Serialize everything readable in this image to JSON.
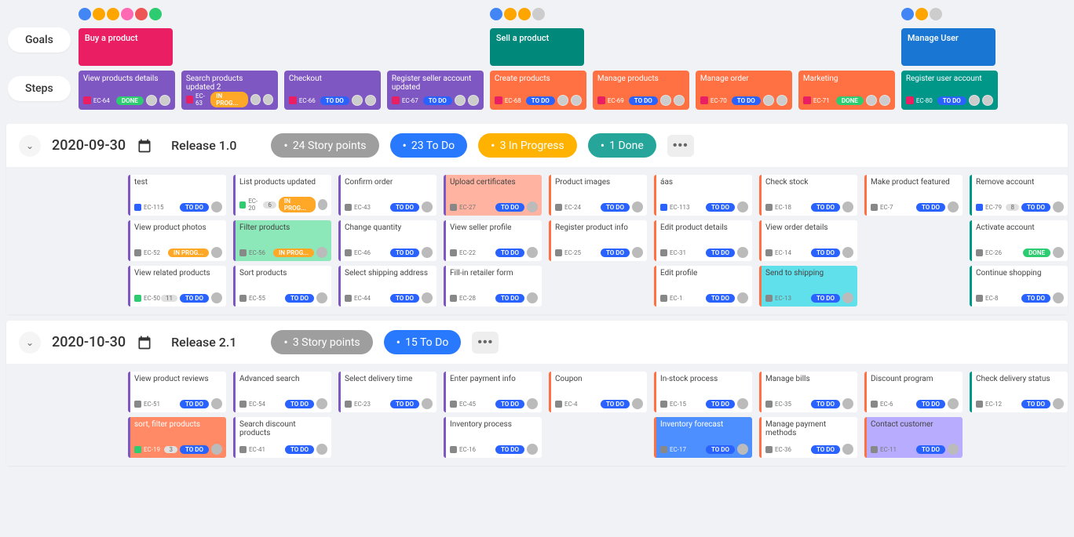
{
  "sideLabels": {
    "goals": "Goals",
    "steps": "Steps"
  },
  "goals": [
    {
      "title": "Buy a product",
      "cardClass": "goal-pink",
      "avatars": [
        "b",
        "o",
        "o",
        "p",
        "r",
        "g"
      ]
    },
    {
      "title": "Sell a product",
      "cardClass": "goal-teal",
      "avatars": [
        "b",
        "o",
        "o",
        "gray"
      ]
    },
    {
      "title": "Manage User",
      "cardClass": "goal-blue",
      "avatars": [
        "b",
        "o",
        "gray"
      ]
    }
  ],
  "steps": [
    {
      "title": "View products details",
      "id": "EC-64",
      "status": "DONE",
      "statusClass": "badge-done",
      "cardClass": "step-purple",
      "col": 0
    },
    {
      "title": "Search products updated 2",
      "id": "EC-63",
      "status": "IN PROG...",
      "statusClass": "badge-prog",
      "cardClass": "step-purple",
      "col": 1
    },
    {
      "title": "Checkout",
      "id": "EC-66",
      "status": "TO DO",
      "statusClass": "badge-todo",
      "cardClass": "step-purple",
      "col": 2
    },
    {
      "title": "Register seller account updated",
      "id": "EC-67",
      "status": "TO DO",
      "statusClass": "badge-todo",
      "cardClass": "step-purple",
      "col": 3
    },
    {
      "title": "Create products",
      "id": "EC-68",
      "status": "TO DO",
      "statusClass": "badge-todo",
      "cardClass": "step-orange",
      "col": 4
    },
    {
      "title": "Manage products",
      "id": "EC-69",
      "status": "TO DO",
      "statusClass": "badge-todo",
      "cardClass": "step-orange",
      "col": 5
    },
    {
      "title": "Manage order",
      "id": "EC-70",
      "status": "TO DO",
      "statusClass": "badge-todo",
      "cardClass": "step-orange",
      "col": 6
    },
    {
      "title": "Marketing",
      "id": "EC-71",
      "status": "DONE",
      "statusClass": "badge-done",
      "cardClass": "step-orange",
      "col": 7
    },
    {
      "title": "Register user account",
      "id": "EC-80",
      "status": "TO DO",
      "statusClass": "badge-todo",
      "cardClass": "step-teal",
      "col": 8
    }
  ],
  "releases": [
    {
      "date": "2020-09-30",
      "name": "Release 1.0",
      "chips": [
        {
          "text": "24 Story points",
          "class": "chip-gray"
        },
        {
          "text": "23 To Do",
          "class": "chip-blue"
        },
        {
          "text": "3 In Progress",
          "class": "chip-orange"
        },
        {
          "text": "1 Done",
          "class": "chip-green"
        }
      ],
      "tasks": [
        {
          "title": "test",
          "id": "EC-115",
          "iconClass": "task",
          "status": "TO DO",
          "statusClass": "badge-todo",
          "borderClass": "bl-purple",
          "col": 0,
          "row": 0
        },
        {
          "title": "List products updated",
          "id": "EC-20",
          "iconClass": "story",
          "count": "6",
          "status": "IN PROG...",
          "statusClass": "badge-prog",
          "borderClass": "bl-purple",
          "col": 1,
          "row": 0
        },
        {
          "title": "Confirm order",
          "id": "EC-43",
          "iconClass": "sub",
          "status": "TO DO",
          "statusClass": "badge-todo",
          "borderClass": "bl-purple",
          "col": 2,
          "row": 0
        },
        {
          "title": "Upload certificates",
          "id": "EC-27",
          "iconClass": "sub",
          "status": "TO DO",
          "statusClass": "badge-todo",
          "borderClass": "bl-purple",
          "hl": "hl-peach",
          "col": 3,
          "row": 0
        },
        {
          "title": "Product images",
          "id": "EC-24",
          "iconClass": "sub",
          "status": "TO DO",
          "statusClass": "badge-todo",
          "borderClass": "bl-orange",
          "col": 4,
          "row": 0
        },
        {
          "title": "áas",
          "id": "EC-113",
          "iconClass": "task",
          "status": "TO DO",
          "statusClass": "badge-todo",
          "borderClass": "bl-orange",
          "col": 5,
          "row": 0
        },
        {
          "title": "Check stock",
          "id": "EC-18",
          "iconClass": "sub",
          "status": "TO DO",
          "statusClass": "badge-todo",
          "borderClass": "bl-orange",
          "col": 6,
          "row": 0
        },
        {
          "title": "Make product featured",
          "id": "EC-7",
          "iconClass": "sub",
          "status": "TO DO",
          "statusClass": "badge-todo",
          "borderClass": "bl-orange",
          "col": 7,
          "row": 0
        },
        {
          "title": "Remove account",
          "id": "EC-79",
          "iconClass": "task",
          "count": "8",
          "status": "TO DO",
          "statusClass": "badge-todo",
          "borderClass": "bl-teal",
          "col": 8,
          "row": 0
        },
        {
          "title": "View product photos",
          "id": "EC-52",
          "iconClass": "sub",
          "status": "IN PROG...",
          "statusClass": "badge-prog",
          "borderClass": "bl-purple",
          "col": 0,
          "row": 1
        },
        {
          "title": "Filter products",
          "id": "EC-56",
          "iconClass": "sub",
          "status": "IN PROG...",
          "statusClass": "badge-prog",
          "borderClass": "bl-purple",
          "hl": "hl-mint",
          "col": 1,
          "row": 1
        },
        {
          "title": "Change quantity",
          "id": "EC-46",
          "iconClass": "sub",
          "status": "TO DO",
          "statusClass": "badge-todo",
          "borderClass": "bl-purple",
          "col": 2,
          "row": 1
        },
        {
          "title": "View seller profile",
          "id": "EC-22",
          "iconClass": "sub",
          "status": "TO DO",
          "statusClass": "badge-todo",
          "borderClass": "bl-purple",
          "col": 3,
          "row": 1
        },
        {
          "title": "Register product info",
          "id": "EC-25",
          "iconClass": "sub",
          "status": "TO DO",
          "statusClass": "badge-todo",
          "borderClass": "bl-orange",
          "col": 4,
          "row": 1
        },
        {
          "title": "Edit product details",
          "id": "EC-31",
          "iconClass": "sub",
          "status": "TO DO",
          "statusClass": "badge-todo",
          "borderClass": "bl-orange",
          "col": 5,
          "row": 1
        },
        {
          "title": "View order details",
          "id": "EC-14",
          "iconClass": "sub",
          "status": "TO DO",
          "statusClass": "badge-todo",
          "borderClass": "bl-orange",
          "col": 6,
          "row": 1
        },
        {
          "title": "Activate account",
          "id": "EC-26",
          "iconClass": "sub",
          "status": "DONE",
          "statusClass": "badge-done",
          "borderClass": "bl-teal",
          "col": 8,
          "row": 1
        },
        {
          "title": "View related products",
          "id": "EC-50",
          "iconClass": "story",
          "count": "11",
          "status": "TO DO",
          "statusClass": "badge-todo",
          "borderClass": "bl-purple",
          "col": 0,
          "row": 2
        },
        {
          "title": "Sort products",
          "id": "EC-55",
          "iconClass": "sub",
          "status": "TO DO",
          "statusClass": "badge-todo",
          "borderClass": "bl-purple",
          "col": 1,
          "row": 2
        },
        {
          "title": "Select shipping address",
          "id": "EC-44",
          "iconClass": "sub",
          "status": "TO DO",
          "statusClass": "badge-todo",
          "borderClass": "bl-purple",
          "col": 2,
          "row": 2
        },
        {
          "title": "Fill-in retailer form",
          "id": "EC-28",
          "iconClass": "sub",
          "status": "TO DO",
          "statusClass": "badge-todo",
          "borderClass": "bl-purple",
          "col": 3,
          "row": 2
        },
        {
          "title": "Edit profile",
          "id": "EC-1",
          "iconClass": "sub",
          "status": "TO DO",
          "statusClass": "badge-todo",
          "borderClass": "bl-orange",
          "col": 5,
          "row": 2
        },
        {
          "title": "Send to shipping",
          "id": "EC-13",
          "iconClass": "sub",
          "status": "TO DO",
          "statusClass": "badge-todo",
          "borderClass": "bl-orange",
          "hl": "hl-cyan",
          "col": 6,
          "row": 2
        },
        {
          "title": "Continue shopping",
          "id": "EC-8",
          "iconClass": "sub",
          "status": "TO DO",
          "statusClass": "badge-todo",
          "borderClass": "bl-teal",
          "col": 8,
          "row": 2
        }
      ],
      "gridRows": 3
    },
    {
      "date": "2020-10-30",
      "name": "Release 2.1",
      "chips": [
        {
          "text": "3 Story points",
          "class": "chip-gray"
        },
        {
          "text": "15 To Do",
          "class": "chip-blue"
        }
      ],
      "tasks": [
        {
          "title": "View product reviews",
          "id": "EC-51",
          "iconClass": "sub",
          "status": "TO DO",
          "statusClass": "badge-todo",
          "borderClass": "bl-purple",
          "col": 0,
          "row": 0
        },
        {
          "title": "Advanced search",
          "id": "EC-54",
          "iconClass": "sub",
          "status": "TO DO",
          "statusClass": "badge-todo",
          "borderClass": "bl-purple",
          "col": 1,
          "row": 0
        },
        {
          "title": "Select delivery time",
          "id": "EC-23",
          "iconClass": "sub",
          "status": "TO DO",
          "statusClass": "badge-todo",
          "borderClass": "bl-purple",
          "col": 2,
          "row": 0
        },
        {
          "title": "Enter payment info",
          "id": "EC-45",
          "iconClass": "sub",
          "status": "TO DO",
          "statusClass": "badge-todo",
          "borderClass": "bl-purple",
          "col": 3,
          "row": 0
        },
        {
          "title": "Coupon",
          "id": "EC-4",
          "iconClass": "sub",
          "status": "TO DO",
          "statusClass": "badge-todo",
          "borderClass": "bl-orange",
          "col": 4,
          "row": 0
        },
        {
          "title": "In-stock process",
          "id": "EC-15",
          "iconClass": "sub",
          "status": "TO DO",
          "statusClass": "badge-todo",
          "borderClass": "bl-orange",
          "col": 5,
          "row": 0
        },
        {
          "title": "Manage bills",
          "id": "EC-35",
          "iconClass": "sub",
          "status": "TO DO",
          "statusClass": "badge-todo",
          "borderClass": "bl-orange",
          "col": 6,
          "row": 0
        },
        {
          "title": "Discount program",
          "id": "EC-6",
          "iconClass": "sub",
          "status": "TO DO",
          "statusClass": "badge-todo",
          "borderClass": "bl-orange",
          "col": 7,
          "row": 0
        },
        {
          "title": "Check delivery status",
          "id": "EC-12",
          "iconClass": "sub",
          "status": "TO DO",
          "statusClass": "badge-todo",
          "borderClass": "bl-teal",
          "col": 8,
          "row": 0
        },
        {
          "title": "sort, filter products",
          "id": "EC-19",
          "iconClass": "story",
          "count": "3",
          "status": "TO DO",
          "statusClass": "badge-todo",
          "borderClass": "bl-purple",
          "hl": "hl-orange",
          "col": 0,
          "row": 1
        },
        {
          "title": "Search discount products",
          "id": "EC-41",
          "iconClass": "sub",
          "status": "TO DO",
          "statusClass": "badge-todo",
          "borderClass": "bl-purple",
          "col": 1,
          "row": 1
        },
        {
          "title": "Inventory process",
          "id": "EC-16",
          "iconClass": "sub",
          "status": "TO DO",
          "statusClass": "badge-todo",
          "borderClass": "bl-purple",
          "col": 3,
          "row": 1
        },
        {
          "title": "Inventory forecast",
          "id": "EC-17",
          "iconClass": "sub",
          "status": "TO DO",
          "statusClass": "badge-todo",
          "borderClass": "bl-orange",
          "hl": "hl-blue",
          "col": 5,
          "row": 1
        },
        {
          "title": "Manage payment methods",
          "id": "EC-36",
          "iconClass": "sub",
          "status": "TO DO",
          "statusClass": "badge-todo",
          "borderClass": "bl-orange",
          "col": 6,
          "row": 1
        },
        {
          "title": "Contact customer",
          "id": "EC-11",
          "iconClass": "sub",
          "status": "TO DO",
          "statusClass": "badge-todo",
          "borderClass": "bl-orange",
          "hl": "hl-lav",
          "col": 7,
          "row": 1
        }
      ],
      "gridRows": 2
    }
  ]
}
